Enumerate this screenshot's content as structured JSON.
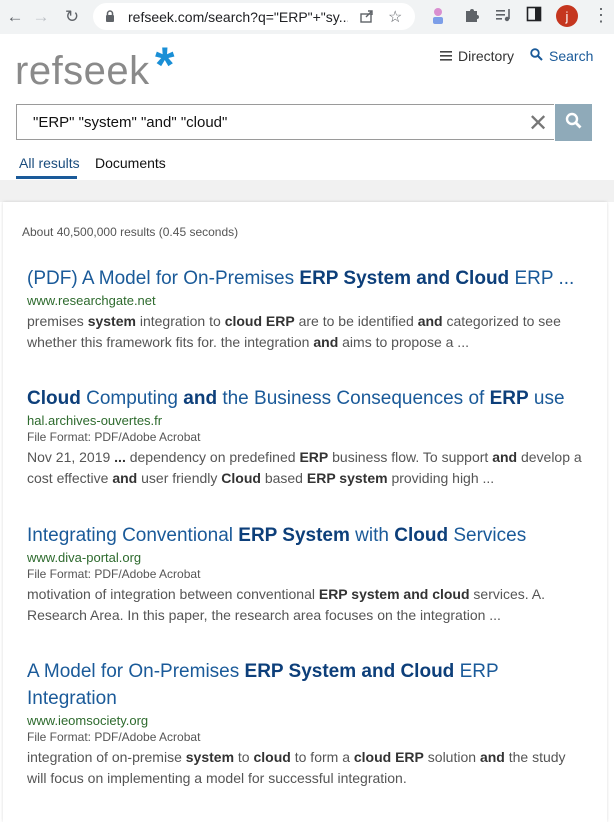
{
  "browser": {
    "url": "refseek.com/search?q=\"ERP\"+\"sy...",
    "avatar_letter": "j"
  },
  "site": {
    "logo_text": "refseek",
    "logo_star": "*",
    "nav_directory": "Directory",
    "nav_search": "Search",
    "query": "\"ERP\" \"system\" \"and\" \"cloud\"",
    "tabs": [
      "All results",
      "Documents"
    ],
    "accent_color": "#1a5a99"
  },
  "results": {
    "stats": "About 40,500,000 results (0.45 seconds)",
    "items": [
      {
        "title": [
          [
            "(PDF) A Model for On-Premises ",
            0
          ],
          [
            "ERP System and Cloud",
            1
          ],
          [
            " ERP ...",
            0
          ]
        ],
        "url": "www.researchgate.net",
        "format": "",
        "snippet": [
          [
            "premises ",
            0
          ],
          [
            "system",
            1
          ],
          [
            " integration to ",
            0
          ],
          [
            "cloud ERP",
            1
          ],
          [
            " are to be identified ",
            0
          ],
          [
            "and",
            1
          ],
          [
            " categorized to see whether this framework fits for. the integration ",
            0
          ],
          [
            "and",
            1
          ],
          [
            " aims to propose a ...",
            0
          ]
        ]
      },
      {
        "title": [
          [
            "Cloud",
            1
          ],
          [
            " Computing ",
            0
          ],
          [
            "and",
            1
          ],
          [
            " the Business Consequences of ",
            0
          ],
          [
            "ERP",
            1
          ],
          [
            " use",
            0
          ]
        ],
        "url": "hal.archives-ouvertes.fr",
        "format": "File Format: PDF/Adobe Acrobat",
        "snippet": [
          [
            "Nov 21, 2019 ",
            0
          ],
          [
            "...",
            1
          ],
          [
            " dependency on predefined ",
            0
          ],
          [
            "ERP",
            1
          ],
          [
            " business flow. To support ",
            0
          ],
          [
            "and",
            1
          ],
          [
            " develop a cost effective ",
            0
          ],
          [
            "and",
            1
          ],
          [
            " user friendly ",
            0
          ],
          [
            "Cloud",
            1
          ],
          [
            " based ",
            0
          ],
          [
            "ERP system",
            1
          ],
          [
            " providing high ...",
            0
          ]
        ]
      },
      {
        "title": [
          [
            "Integrating Conventional ",
            0
          ],
          [
            "ERP System",
            1
          ],
          [
            " with ",
            0
          ],
          [
            "Cloud",
            1
          ],
          [
            " Services",
            0
          ]
        ],
        "url": "www.diva-portal.org",
        "format": "File Format: PDF/Adobe Acrobat",
        "snippet": [
          [
            "motivation of integration between conventional ",
            0
          ],
          [
            "ERP system and cloud",
            1
          ],
          [
            " services. A. Research Area. In this paper, the research area focuses on the integration ...",
            0
          ]
        ]
      },
      {
        "title": [
          [
            "A Model for On-Premises ",
            0
          ],
          [
            "ERP System and Cloud",
            1
          ],
          [
            " ERP Integration",
            0
          ]
        ],
        "url": "www.ieomsociety.org",
        "format": "File Format: PDF/Adobe Acrobat",
        "snippet": [
          [
            "integration of on-premise ",
            0
          ],
          [
            "system",
            1
          ],
          [
            " to ",
            0
          ],
          [
            "cloud",
            1
          ],
          [
            " to form a ",
            0
          ],
          [
            "cloud ERP",
            1
          ],
          [
            " solution ",
            0
          ],
          [
            "and",
            1
          ],
          [
            " the study will focus on implementing a model for successful integration.",
            0
          ]
        ]
      }
    ]
  }
}
